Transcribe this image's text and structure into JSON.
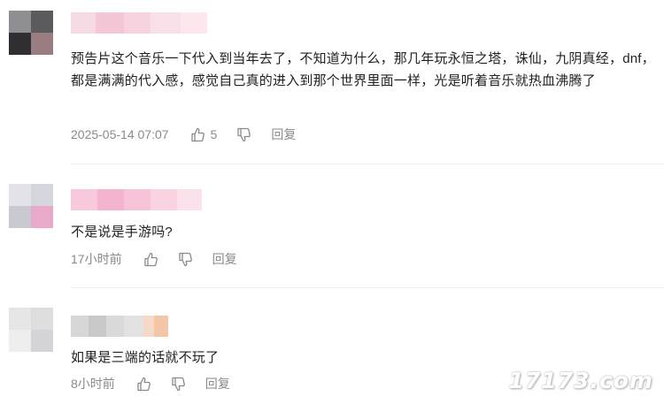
{
  "comments": [
    {
      "text": "预告片这个音乐一下代入到当年去了，不知道为什么，那几年玩永恒之塔，诛仙，九阴真经，dnf，都是满满的代入感，感觉自己真的进入到那个世界里面一样，光是听着音乐就热血沸腾了",
      "time": "2025-05-14 07:07",
      "likes": "5",
      "reply_label": "回复",
      "avatar_color_1": "#3a3a3a",
      "avatar_color_2": "#7d6e70"
    },
    {
      "text": "不是说是手游吗?",
      "time": "17小时前",
      "likes": "",
      "reply_label": "回复",
      "avatar_color_1": "#d9d9df",
      "avatar_color_2": "#e8a8c6"
    },
    {
      "text": "如果是三端的话就不玩了",
      "time": "8小时前",
      "likes": "",
      "reply_label": "回复",
      "avatar_color_1": "#dcdcdc",
      "avatar_color_2": "#eaeaea"
    }
  ],
  "icons": {
    "like": "thumbs-up-icon",
    "dislike": "thumbs-down-icon"
  },
  "watermark": "17173.com"
}
